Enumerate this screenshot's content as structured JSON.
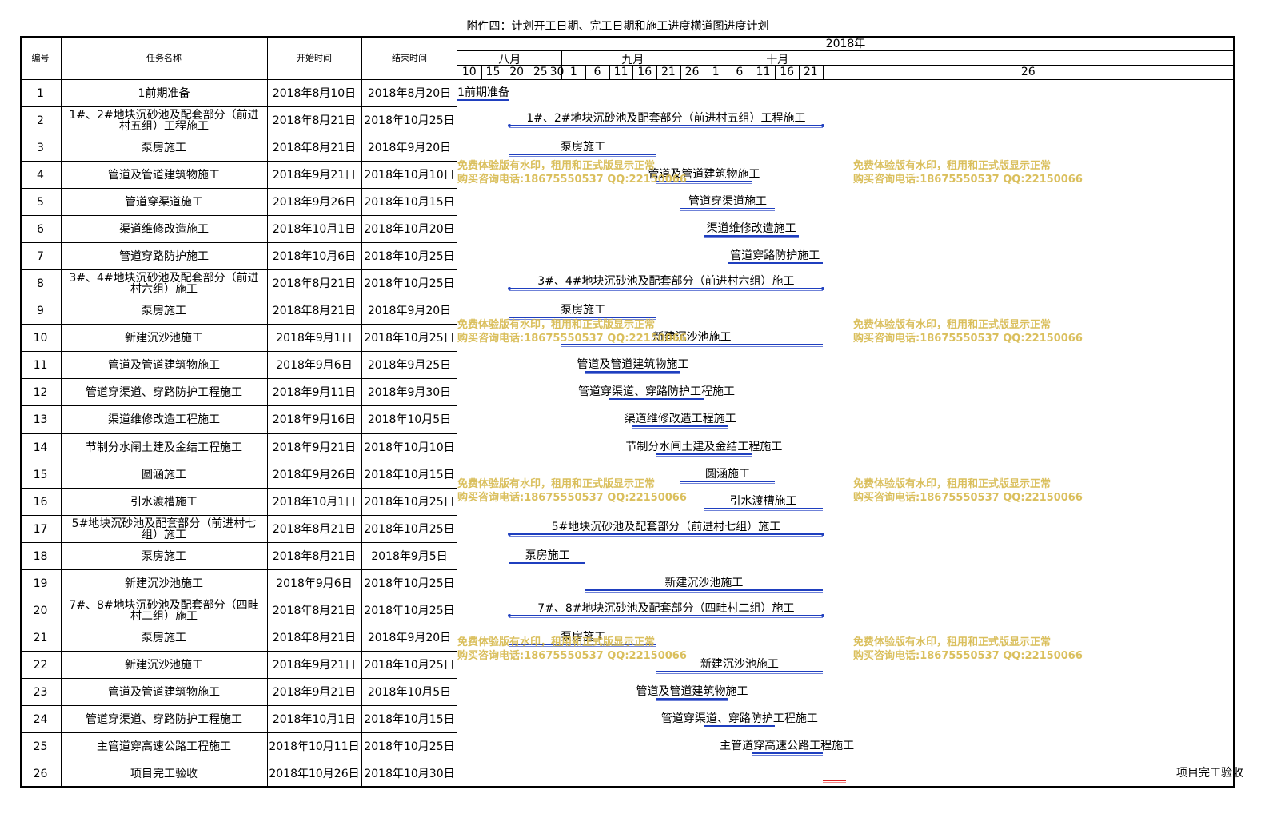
{
  "title": "附件四：计划开工日期、完工日期和施工进度横道图进度计划",
  "headers": {
    "no": "编号",
    "task": "任务名称",
    "start": "开始时间",
    "end": "结束时间",
    "year": "2018年"
  },
  "months": [
    "八月",
    "九月",
    "十月"
  ],
  "day_ticks": [
    "10",
    "15",
    "20",
    "25",
    "30",
    "1",
    "6",
    "11",
    "16",
    "21",
    "26",
    "1",
    "6",
    "11",
    "16",
    "21",
    "26"
  ],
  "rows": [
    {
      "no": "1",
      "task": "1前期准备",
      "start": "2018年8月10日",
      "end": "2018年8月20日",
      "bar_label": "1前期准备"
    },
    {
      "no": "2",
      "task": "1#、2#地块沉砂池及配套部分（前进村五组）工程施工",
      "start": "2018年8月21日",
      "end": "2018年10月25日",
      "bar_label": "1#、2#地块沉砂池及配套部分（前进村五组）工程施工"
    },
    {
      "no": "3",
      "task": "泵房施工",
      "start": "2018年8月21日",
      "end": "2018年9月20日",
      "bar_label": "泵房施工"
    },
    {
      "no": "4",
      "task": "管道及管道建筑物施工",
      "start": "2018年9月21日",
      "end": "2018年10月10日",
      "bar_label": "管道及管道建筑物施工"
    },
    {
      "no": "5",
      "task": "管道穿渠道施工",
      "start": "2018年9月26日",
      "end": "2018年10月15日",
      "bar_label": "管道穿渠道施工"
    },
    {
      "no": "6",
      "task": "渠道维修改造施工",
      "start": "2018年10月1日",
      "end": "2018年10月20日",
      "bar_label": "渠道维修改造施工"
    },
    {
      "no": "7",
      "task": "管道穿路防护施工",
      "start": "2018年10月6日",
      "end": "2018年10月25日",
      "bar_label": "管道穿路防护施工"
    },
    {
      "no": "8",
      "task": "3#、4#地块沉砂池及配套部分（前进村六组）施工",
      "start": "2018年8月21日",
      "end": "2018年10月25日",
      "bar_label": "3#、4#地块沉砂池及配套部分（前进村六组）施工"
    },
    {
      "no": "9",
      "task": "泵房施工",
      "start": "2018年8月21日",
      "end": "2018年9月20日",
      "bar_label": "泵房施工"
    },
    {
      "no": "10",
      "task": "新建沉沙池施工",
      "start": "2018年9月1日",
      "end": "2018年10月25日",
      "bar_label": "新建沉沙池施工"
    },
    {
      "no": "11",
      "task": "管道及管道建筑物施工",
      "start": "2018年9月6日",
      "end": "2018年9月25日",
      "bar_label": "管道及管道建筑物施工"
    },
    {
      "no": "12",
      "task": "管道穿渠道、穿路防护工程施工",
      "start": "2018年9月11日",
      "end": "2018年9月30日",
      "bar_label": "管道穿渠道、穿路防护工程施工"
    },
    {
      "no": "13",
      "task": "渠道维修改造工程施工",
      "start": "2018年9月16日",
      "end": "2018年10月5日",
      "bar_label": "渠道维修改造工程施工"
    },
    {
      "no": "14",
      "task": "节制分水闸土建及金结工程施工",
      "start": "2018年9月21日",
      "end": "2018年10月10日",
      "bar_label": "节制分水闸土建及金结工程施工"
    },
    {
      "no": "15",
      "task": "圆涵施工",
      "start": "2018年9月26日",
      "end": "2018年10月15日",
      "bar_label": "圆涵施工"
    },
    {
      "no": "16",
      "task": "引水渡槽施工",
      "start": "2018年10月1日",
      "end": "2018年10月25日",
      "bar_label": "引水渡槽施工"
    },
    {
      "no": "17",
      "task": "5#地块沉砂池及配套部分（前进村七组）施工",
      "start": "2018年8月21日",
      "end": "2018年10月25日",
      "bar_label": "5#地块沉砂池及配套部分（前进村七组）施工"
    },
    {
      "no": "18",
      "task": "泵房施工",
      "start": "2018年8月21日",
      "end": "2018年9月5日",
      "bar_label": "泵房施工"
    },
    {
      "no": "19",
      "task": "新建沉沙池施工",
      "start": "2018年9月6日",
      "end": "2018年10月25日",
      "bar_label": "新建沉沙池施工"
    },
    {
      "no": "20",
      "task": "7#、8#地块沉砂池及配套部分（四畦村二组）施工",
      "start": "2018年8月21日",
      "end": "2018年10月25日",
      "bar_label": "7#、8#地块沉砂池及配套部分（四畦村二组）施工"
    },
    {
      "no": "21",
      "task": "泵房施工",
      "start": "2018年8月21日",
      "end": "2018年9月20日",
      "bar_label": "泵房施工"
    },
    {
      "no": "22",
      "task": "新建沉沙池施工",
      "start": "2018年9月21日",
      "end": "2018年10月25日",
      "bar_label": "新建沉沙池施工"
    },
    {
      "no": "23",
      "task": "管道及管道建筑物施工",
      "start": "2018年9月21日",
      "end": "2018年10月5日",
      "bar_label": "管道及管道建筑物施工"
    },
    {
      "no": "24",
      "task": "管道穿渠道、穿路防护工程施工",
      "start": "2018年10月1日",
      "end": "2018年10月15日",
      "bar_label": "管道穿渠道、穿路防护工程施工"
    },
    {
      "no": "25",
      "task": "主管道穿高速公路工程施工",
      "start": "2018年10月11日",
      "end": "2018年10月25日",
      "bar_label": "主管道穿高速公路工程施工"
    },
    {
      "no": "26",
      "task": "项目完工验收",
      "start": "2018年10月26日",
      "end": "2018年10月30日",
      "bar_label": "项目完工验收"
    }
  ],
  "watermark": {
    "line1": "免费体验版有水印，租用和正式版显示正常",
    "line2": "购买咨询电话:18675550537 QQ:22150066"
  },
  "colors": {
    "bar": "#1f3fbf",
    "final_bar": "#d22222",
    "watermark": "#d6b94c"
  }
}
